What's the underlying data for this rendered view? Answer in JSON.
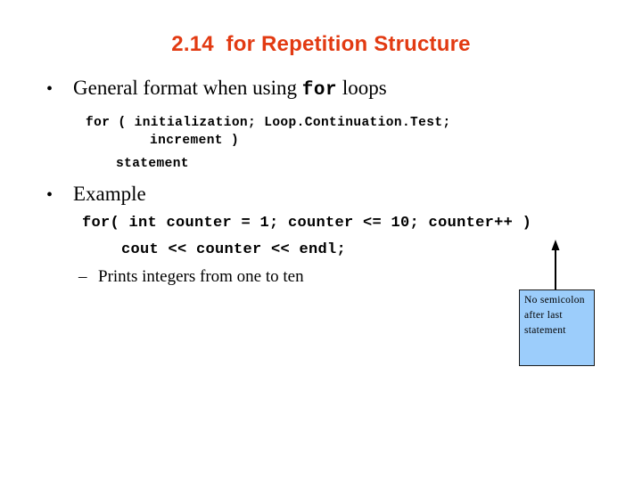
{
  "slide": {
    "title": "2.14  for Repetition Structure",
    "title_color": "#E23A12",
    "background_color": "#FFFFFF"
  },
  "bullets": {
    "general_format": {
      "marker": "•",
      "text_before": "General format when using ",
      "keyword": "for",
      "text_after": " loops"
    },
    "example": {
      "marker": "•",
      "text": "Example"
    },
    "prints": {
      "marker": "–",
      "text": "Prints integers from one to ten"
    }
  },
  "code_format": {
    "line1": "for ( initialization; Loop.Continuation.Test;",
    "line2": "increment )",
    "line3": "statement"
  },
  "code_example": {
    "line1": "for( int counter = 1; counter <= 10; counter++ )",
    "line2": "cout << counter << endl;"
  },
  "callout": {
    "text": "No semicolon after last statement",
    "fill_color": "#9CCDFB",
    "border_color": "#1A1A1A",
    "arrow_direction": "up"
  }
}
